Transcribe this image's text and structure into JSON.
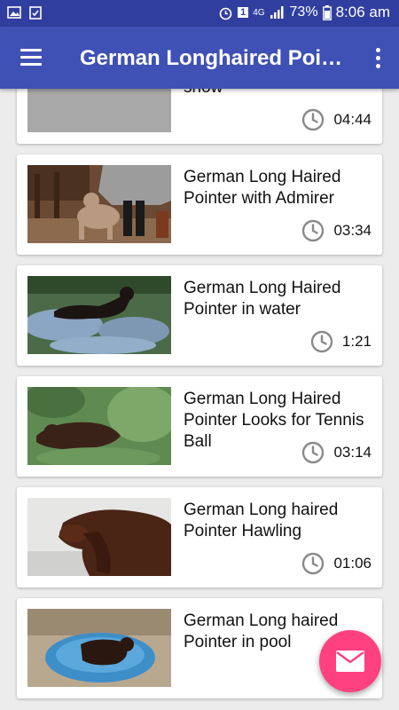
{
  "status_bar": {
    "time": "8:06 am",
    "battery": "73%",
    "network": "4G",
    "sim": "1"
  },
  "app_bar": {
    "title": "German Longhaired Poin…",
    "menu_icon": "hamburger-menu-icon",
    "overflow_icon": "more-vert-icon"
  },
  "videos": [
    {
      "title": "pointers running in the snow",
      "duration": "04:44",
      "thumb": "grey-placeholder"
    },
    {
      "title": "German Long Haired Pointer with Admirer",
      "duration": "03:34",
      "thumb": "dog-with-people"
    },
    {
      "title": "German Long Haired Pointer in water",
      "duration": "1:21",
      "thumb": "dog-in-water"
    },
    {
      "title": "German Long Haired Pointer Looks for Tennis Ball",
      "duration": "03:14",
      "thumb": "dog-in-bushes"
    },
    {
      "title": "German Long haired Pointer Hawling",
      "duration": "01:06",
      "thumb": "dog-lying-floor"
    },
    {
      "title": "German Long haired Pointer in pool",
      "duration": "",
      "thumb": "dog-in-pool"
    }
  ],
  "fab": {
    "icon": "mail-icon"
  },
  "colors": {
    "status_bar": "#303f9f",
    "app_bar": "#3f51b5",
    "fab": "#ff4081",
    "background": "#ececec"
  }
}
